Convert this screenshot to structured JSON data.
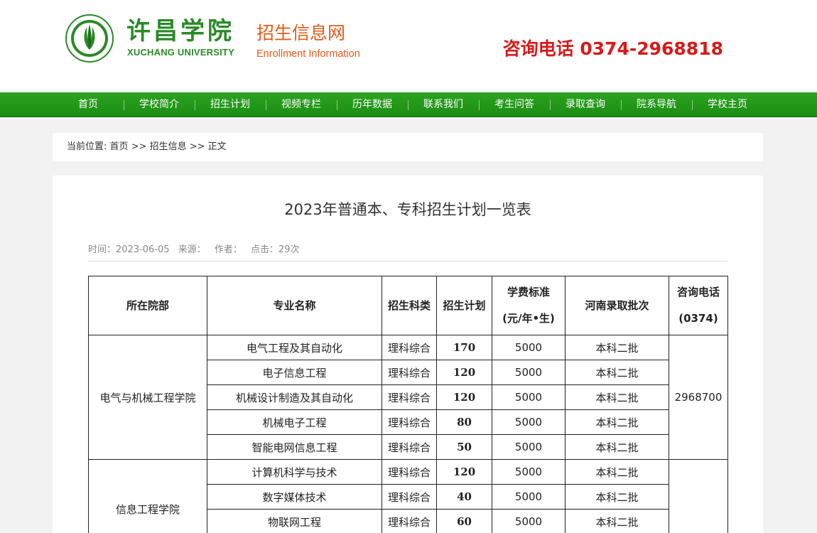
{
  "header": {
    "school_name_cn": "许昌学院",
    "school_name_en": "XUCHANG UNIVERSITY",
    "site_name_cn": "招生信息网",
    "site_name_en": "Enrollment Information",
    "hotline": "咨询电话 0374-2968818",
    "brand_green": "#2a8a26",
    "brand_orange": "#e35b1a",
    "hotline_red": "#d71a1a"
  },
  "nav": {
    "items": [
      {
        "label": "首页"
      },
      {
        "label": "学校简介"
      },
      {
        "label": "招生计划"
      },
      {
        "label": "视频专栏"
      },
      {
        "label": "历年数据"
      },
      {
        "label": "联系我们"
      },
      {
        "label": "考生问答"
      },
      {
        "label": "录取查询"
      },
      {
        "label": "院系导航"
      },
      {
        "label": "学校主页"
      }
    ]
  },
  "breadcrumb": {
    "prefix": "当前位置: ",
    "home": "首页",
    "sep1": " >> ",
    "section": "招生信息",
    "sep2": " >> ",
    "current": "正文"
  },
  "article": {
    "title": "2023年普通本、专科招生计划一览表",
    "meta": {
      "time": "时间：2023-06-05",
      "source": "来源：",
      "author": "作者：",
      "clicks": "点击：29次"
    }
  },
  "table": {
    "headers": {
      "dept": "所在院部",
      "major": "专业名称",
      "category": "招生科类",
      "plan": "招生计划",
      "fee_line1": "学费标准",
      "fee_line2": "(元/年•生)",
      "batch": "河南录取批次",
      "phone_line1": "咨询电话",
      "phone_line2": "(0374)"
    },
    "groups": [
      {
        "dept": "电气与机械工程学院",
        "phone": "2968700",
        "rows": [
          {
            "major": "电气工程及其自动化",
            "category": "理科综合",
            "plan": "170",
            "fee": "5000",
            "batch": "本科二批"
          },
          {
            "major": "电子信息工程",
            "category": "理科综合",
            "plan": "120",
            "fee": "5000",
            "batch": "本科二批"
          },
          {
            "major": "机械设计制造及其自动化",
            "category": "理科综合",
            "plan": "120",
            "fee": "5000",
            "batch": "本科二批"
          },
          {
            "major": "机械电子工程",
            "category": "理科综合",
            "plan": "80",
            "fee": "5000",
            "batch": "本科二批"
          },
          {
            "major": "智能电网信息工程",
            "category": "理科综合",
            "plan": "50",
            "fee": "5000",
            "batch": "本科二批"
          }
        ]
      },
      {
        "dept": "信息工程学院",
        "phone": "",
        "rows": [
          {
            "major": "计算机科学与技术",
            "category": "理科综合",
            "plan": "120",
            "fee": "5000",
            "batch": "本科二批"
          },
          {
            "major": "数字媒体技术",
            "category": "理科综合",
            "plan": "40",
            "fee": "5000",
            "batch": "本科二批"
          },
          {
            "major": "物联网工程",
            "category": "理科综合",
            "plan": "60",
            "fee": "5000",
            "batch": "本科二批"
          }
        ]
      }
    ]
  }
}
